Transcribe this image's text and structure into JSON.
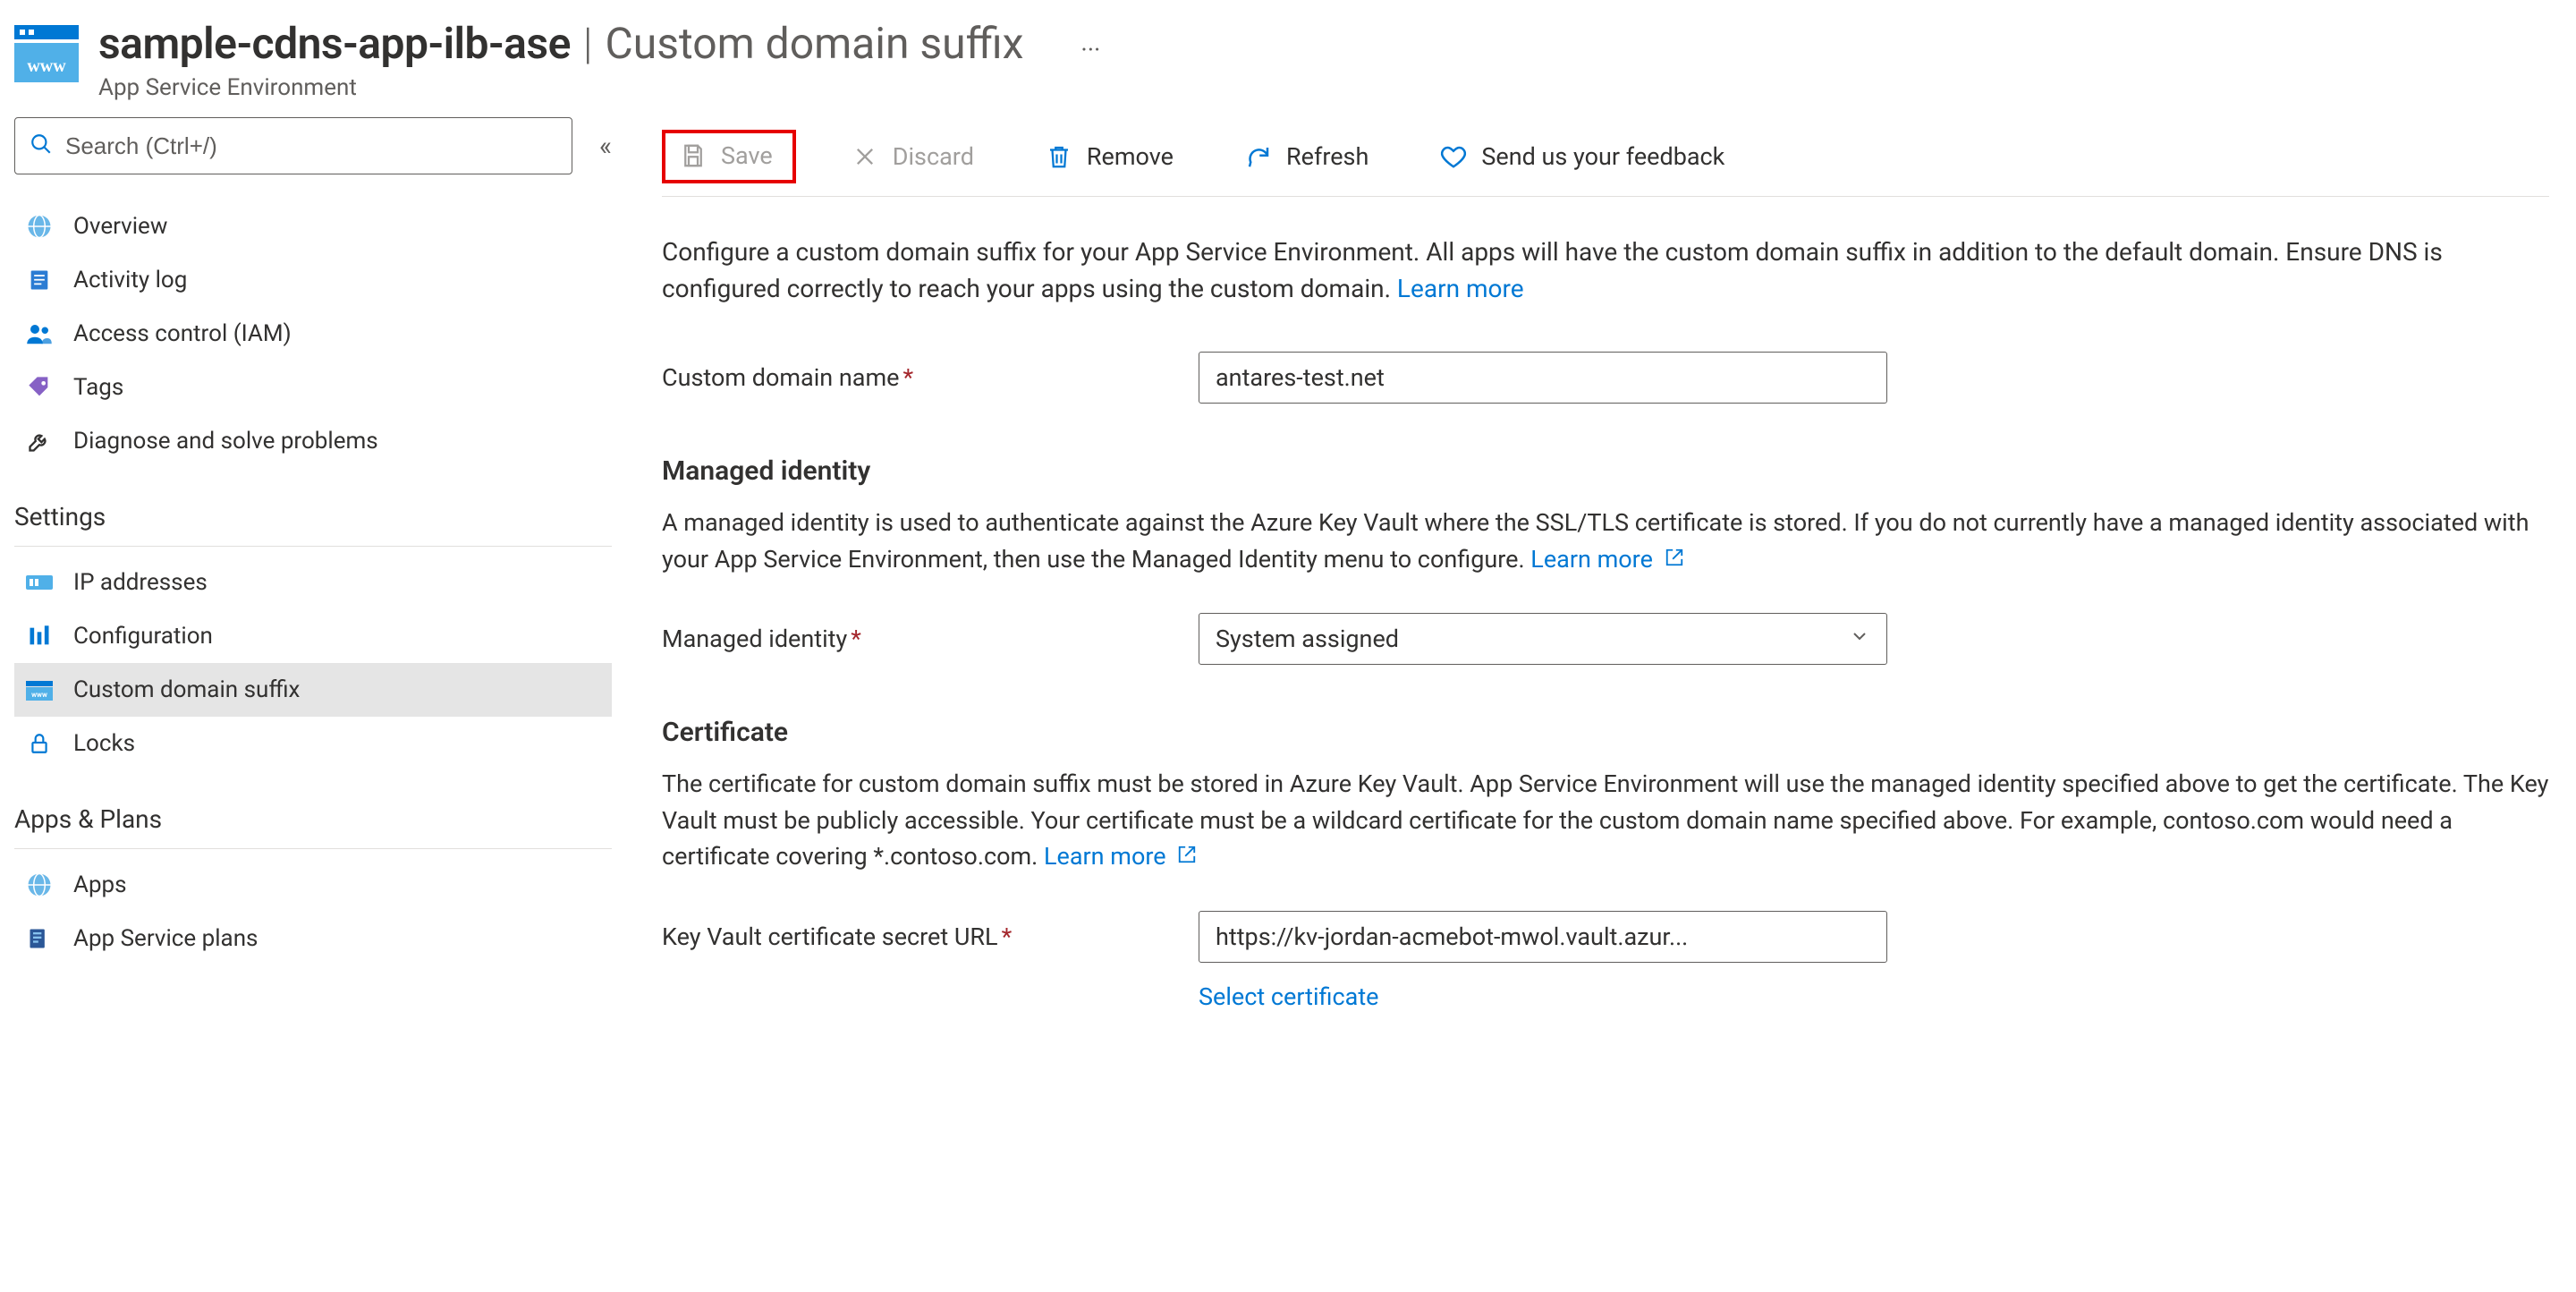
{
  "header": {
    "resource_name": "sample-cdns-app-ilb-ase",
    "page_name": "Custom domain suffix",
    "resource_type": "App Service Environment",
    "more": "···"
  },
  "sidebar": {
    "search_placeholder": "Search (Ctrl+/)",
    "general": [
      {
        "icon": "globe-icon",
        "label": "Overview"
      },
      {
        "icon": "log-icon",
        "label": "Activity log"
      },
      {
        "icon": "people-icon",
        "label": "Access control (IAM)"
      },
      {
        "icon": "tag-icon",
        "label": "Tags"
      },
      {
        "icon": "wrench-icon",
        "label": "Diagnose and solve problems"
      }
    ],
    "settings_title": "Settings",
    "settings": [
      {
        "icon": "ip-icon",
        "label": "IP addresses"
      },
      {
        "icon": "bars-icon",
        "label": "Configuration"
      },
      {
        "icon": "www-icon",
        "label": "Custom domain suffix",
        "active": true
      },
      {
        "icon": "lock-icon",
        "label": "Locks"
      }
    ],
    "apps_title": "Apps & Plans",
    "apps": [
      {
        "icon": "globe-icon",
        "label": "Apps"
      },
      {
        "icon": "plan-icon",
        "label": "App Service plans"
      }
    ]
  },
  "commands": {
    "save": "Save",
    "discard": "Discard",
    "remove": "Remove",
    "refresh": "Refresh",
    "feedback": "Send us your feedback"
  },
  "intro": {
    "text": "Configure a custom domain suffix for your App Service Environment. All apps will have the custom domain suffix in addition to the default domain. Ensure DNS is configured correctly to reach your apps using the custom domain. ",
    "learn_more": "Learn more"
  },
  "fields": {
    "custom_domain_label": "Custom domain name",
    "custom_domain_value": "antares-test.net",
    "managed_identity_section": "Managed identity",
    "managed_identity_text": "A managed identity is used to authenticate against the Azure Key Vault where the SSL/TLS certificate is stored. If you do not currently have a managed identity associated with your App Service Environment, then use the Managed Identity menu to configure. ",
    "managed_identity_learn_more": "Learn more",
    "managed_identity_label": "Managed identity",
    "managed_identity_value": "System assigned",
    "certificate_section": "Certificate",
    "certificate_text": "The certificate for custom domain suffix must be stored in Azure Key Vault. App Service Environment will use the managed identity specified above to get the certificate. The Key Vault must be publicly accessible. Your certificate must be a wildcard certificate for the custom domain name specified above. For example, contoso.com would need a certificate covering *.contoso.com. ",
    "certificate_learn_more": "Learn more",
    "kv_url_label": "Key Vault certificate secret URL",
    "kv_url_value": "https://kv-jordan-acmebot-mwol.vault.azur...",
    "select_certificate": "Select certificate"
  }
}
